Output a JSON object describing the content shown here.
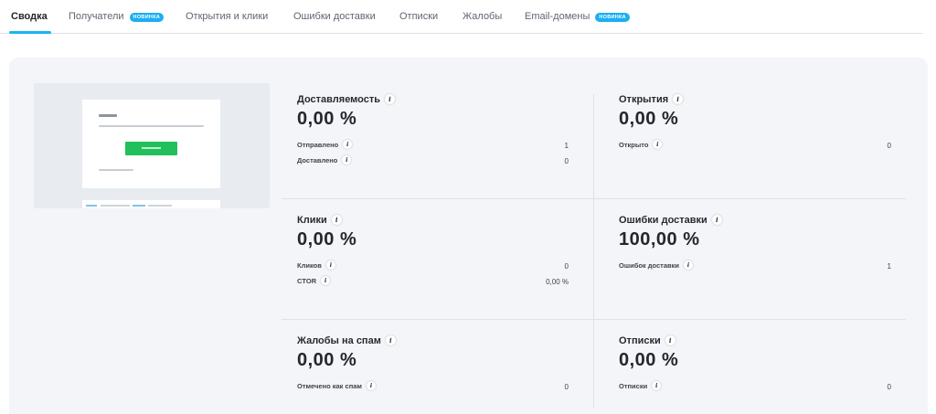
{
  "tabs": [
    {
      "label": "Сводка",
      "active": true,
      "badge": ""
    },
    {
      "label": "Получатели",
      "active": false,
      "badge": "Новинка"
    },
    {
      "label": "Открытия и клики",
      "active": false,
      "badge": ""
    },
    {
      "label": "Ошибки доставки",
      "active": false,
      "badge": ""
    },
    {
      "label": "Отписки",
      "active": false,
      "badge": ""
    },
    {
      "label": "Жалобы",
      "active": false,
      "badge": ""
    },
    {
      "label": "Email-домены",
      "active": false,
      "badge": "Новинка"
    }
  ],
  "info_glyph": "i",
  "metrics": {
    "deliverability": {
      "title": "Доставляемость",
      "value": "0,00 %",
      "rows": [
        {
          "label": "Отправлено",
          "value": "1"
        },
        {
          "label": "Доставлено",
          "value": "0"
        }
      ]
    },
    "opens": {
      "title": "Открытия",
      "value": "0,00 %",
      "rows": [
        {
          "label": "Открыто",
          "value": "0"
        }
      ]
    },
    "clicks": {
      "title": "Клики",
      "value": "0,00 %",
      "rows": [
        {
          "label": "Кликов",
          "value": "0"
        },
        {
          "label": "CTOR",
          "value": "0,00 %"
        }
      ]
    },
    "bounces": {
      "title": "Ошибки доставки",
      "value": "100,00 %",
      "rows": [
        {
          "label": "Ошибок доставки",
          "value": "1"
        }
      ]
    },
    "spam": {
      "title": "Жалобы на спам",
      "value": "0,00 %",
      "rows": [
        {
          "label": "Отмечено как спам",
          "value": "0"
        }
      ]
    },
    "unsubscribes": {
      "title": "Отписки",
      "value": "0,00 %",
      "rows": [
        {
          "label": "Отписки",
          "value": "0"
        }
      ]
    }
  },
  "colors": {
    "accent": "#1ab4f0",
    "badge": "#1aaff0",
    "cta_green": "#21c05a",
    "card_bg": "#f3f5f9"
  }
}
